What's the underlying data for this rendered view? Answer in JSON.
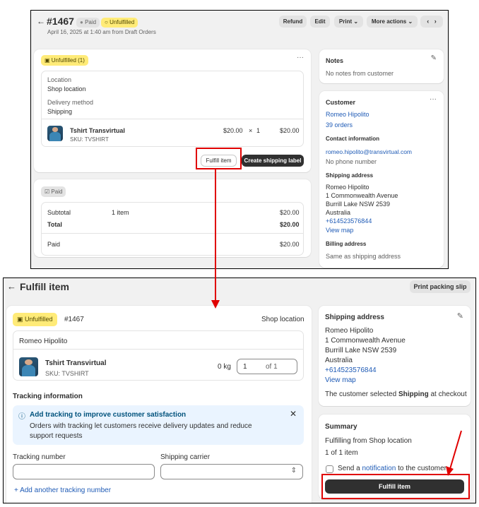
{
  "order_page": {
    "back_icon": "arrow-left-icon",
    "order_number": "#1467",
    "badge_paid": "Paid",
    "badge_unfulfilled": "Unfulfilled",
    "subtitle": "April 16, 2025 at 1:40 am from Draft Orders",
    "actions": {
      "refund": "Refund",
      "edit": "Edit",
      "print": "Print",
      "more_actions": "More actions"
    },
    "fulfill_card": {
      "badge": "Unfulfilled (1)",
      "location_label": "Location",
      "location_value": "Shop location",
      "delivery_label": "Delivery method",
      "delivery_value": "Shipping",
      "item_name": "Tshirt Transvirtual",
      "item_sku": "SKU: TVSHIRT",
      "item_price": "$20.00",
      "item_times": "×",
      "item_qty": "1",
      "item_total": "$20.00",
      "fulfill_btn": "Fulfill item",
      "shipping_label_btn": "Create shipping label"
    },
    "payment_card": {
      "badge": "Paid",
      "subtotal_label": "Subtotal",
      "subtotal_items": "1 item",
      "subtotal_value": "$20.00",
      "total_label": "Total",
      "total_value": "$20.00",
      "paid_label": "Paid",
      "paid_value": "$20.00"
    },
    "notes": {
      "title": "Notes",
      "text": "No notes from customer"
    },
    "customer": {
      "title": "Customer",
      "name": "Romeo Hipolito",
      "orders": "39 orders",
      "contact_title": "Contact information",
      "email": "romeo.hipolito@transvirtual.com",
      "phone": "No phone number",
      "shipping_title": "Shipping address",
      "address": [
        "Romeo Hipolito",
        "1 Commonwealth Avenue",
        "Burrill Lake NSW 2539",
        "Australia"
      ],
      "address_phone": "+614523576844",
      "view_map": "View map",
      "billing_title": "Billing address",
      "billing_text": "Same as shipping address"
    }
  },
  "fulfill_page": {
    "title": "Fulfill item",
    "print_slip": "Print packing slip",
    "badge": "Unfulfilled",
    "order_number": "#1467",
    "location": "Shop location",
    "recipient": "Romeo Hipolito",
    "item_name": "Tshirt Transvirtual",
    "item_sku": "SKU: TVSHIRT",
    "weight": "0 kg",
    "qty_value": "1",
    "qty_of": "of 1",
    "tracking_title": "Tracking information",
    "banner_title": "Add tracking to improve customer satisfaction",
    "banner_text": "Orders with tracking let customers receive delivery updates and reduce support requests",
    "tracking_number_label": "Tracking number",
    "carrier_label": "Shipping carrier",
    "add_tracking": "Add another tracking number",
    "shipping": {
      "title": "Shipping address",
      "address": [
        "Romeo Hipolito",
        "1 Commonwealth Avenue",
        "Burrill Lake NSW 2539",
        "Australia"
      ],
      "phone": "+614523576844",
      "view_map": "View map",
      "note_prefix": "The customer selected ",
      "note_bold": "Shipping",
      "note_suffix": " at checkout"
    },
    "summary": {
      "title": "Summary",
      "fulfilling_from": "Fulfilling from Shop location",
      "count": "1 of 1 item",
      "notify_prefix": "Send a ",
      "notify_link": "notification",
      "notify_suffix": " to the customer",
      "fulfill_btn": "Fulfill item"
    }
  },
  "colors": {
    "highlight": "#e00000",
    "badge_yellow": "#ffeb78",
    "link": "#1f5bb6",
    "banner": "#eaf4ff"
  }
}
